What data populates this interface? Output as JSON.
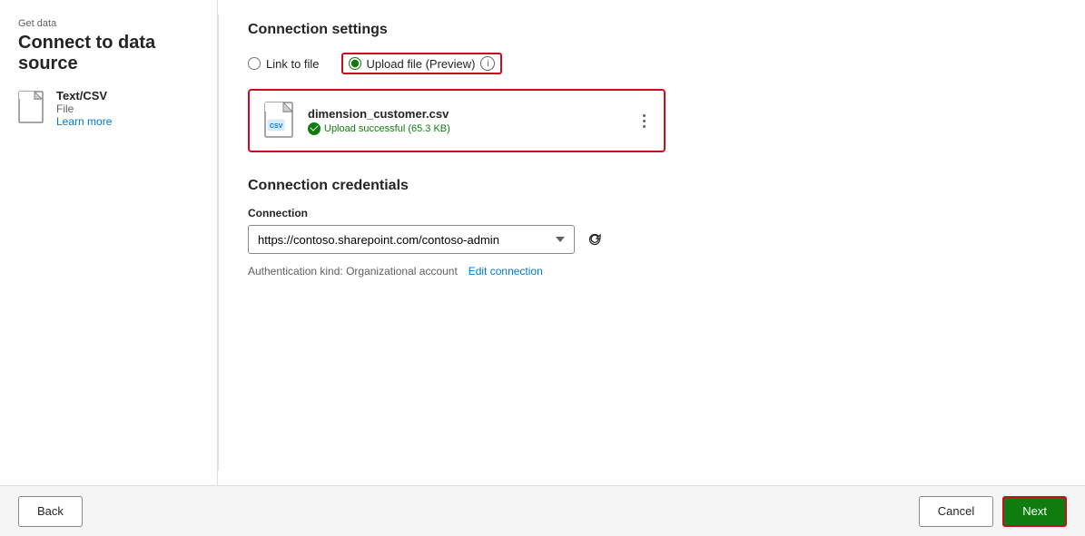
{
  "header": {
    "breadcrumb": "Get data",
    "title": "Connect to data source"
  },
  "sidebar": {
    "item": {
      "icon_type": "text_csv",
      "name": "Text/CSV",
      "type": "File",
      "learn_more": "Learn more"
    }
  },
  "connection_settings": {
    "section_title": "Connection settings",
    "radio_link": "Link to file",
    "radio_upload": "Upload file (Preview)",
    "info_icon": "i",
    "upload_card": {
      "filename": "dimension_customer.csv",
      "status_text": "Upload successful (65.3 KB)"
    }
  },
  "connection_credentials": {
    "section_title": "Connection credentials",
    "field_label": "Connection",
    "connection_value": "https://contoso.sharepoint.com/contoso-admin",
    "auth_text": "Authentication kind: Organizational account",
    "edit_link": "Edit connection"
  },
  "footer": {
    "back_label": "Back",
    "cancel_label": "Cancel",
    "next_label": "Next"
  }
}
